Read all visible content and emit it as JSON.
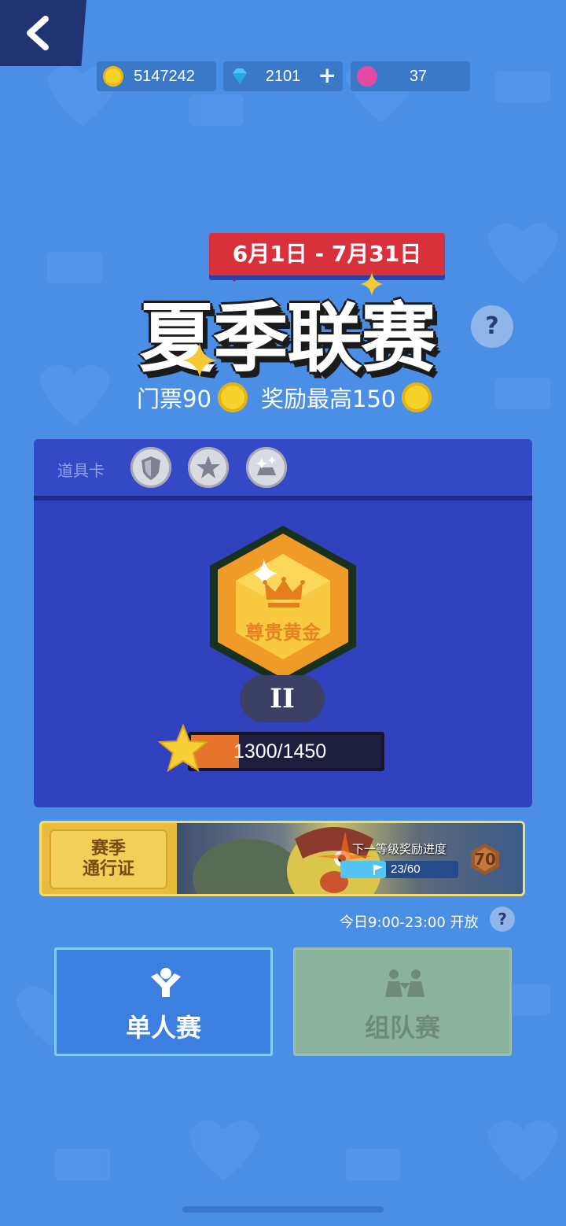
{
  "currency": {
    "coins": "5147242",
    "gems": "2101",
    "gems_add": "+",
    "lotus": "37"
  },
  "event": {
    "date_range": "6月1日 - 7月31日",
    "title": "夏季联赛",
    "ticket_label": "门票90",
    "reward_label": "奖励最高150",
    "help": "?"
  },
  "panel": {
    "cards_label": "道具卡",
    "rank_name": "尊贵黄金",
    "rank_tier": "II",
    "progress_text": "1300/1450",
    "progress_current": 1300,
    "progress_max": 1450
  },
  "pass": {
    "ticket_text_line1": "赛季",
    "ticket_text_line2": "通行证",
    "next_reward_label": "下一等级奖励进度",
    "next_progress_text": "23/60",
    "next_progress_current": 23,
    "next_progress_max": 60,
    "level": "70"
  },
  "schedule": {
    "open_text": "今日9:00-23:00 开放",
    "help": "?"
  },
  "modes": {
    "single_label": "单人赛",
    "team_label": "组队赛"
  },
  "colors": {
    "background": "#4b8ee6",
    "panel": "#2f41bd",
    "date_banner": "#d8313b",
    "progress": "#e8732c",
    "gold": "#f6d22a"
  }
}
